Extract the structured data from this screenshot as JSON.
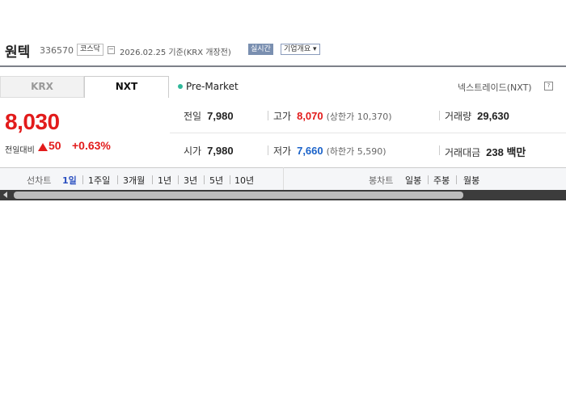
{
  "header": {
    "name": "원텍",
    "code": "336570",
    "market": "코스닥",
    "date": "2026.02.25 기준(KRX 개장전)",
    "realtime_label": "실시간",
    "corp_label": "기업개요 ▾"
  },
  "tabs": {
    "krx": "KRX",
    "nxt": "NXT"
  },
  "price": {
    "current": "8,030",
    "change_label": "전일대비",
    "change_value": "50",
    "change_pct": "+0.63%",
    "direction": "up"
  },
  "status": {
    "session": "Pre-Market",
    "exchange": "넥스트레이드(NXT)",
    "help": "?"
  },
  "stats": {
    "prev_close_label": "전일",
    "prev_close": "7,980",
    "high_label": "고가",
    "high": "8,070",
    "upper_limit": "(상한가 10,370)",
    "volume_label": "거래량",
    "volume": "29,630",
    "open_label": "시가",
    "open": "7,980",
    "low_label": "저가",
    "low": "7,660",
    "lower_limit": "(하한가 5,590)",
    "amount_label": "거래대금",
    "amount": "238 백만"
  },
  "line_chart": {
    "label": "선차트",
    "periods": [
      "1일",
      "1주일",
      "3개월",
      "1년",
      "3년",
      "5년",
      "10년"
    ],
    "active": "1일"
  },
  "candle_chart": {
    "label": "봉차트",
    "periods": [
      "일봉",
      "주봉",
      "월봉"
    ]
  },
  "colors": {
    "up": "#e21b1b",
    "down": "#1a62c9",
    "active": "#2a4fc0"
  }
}
